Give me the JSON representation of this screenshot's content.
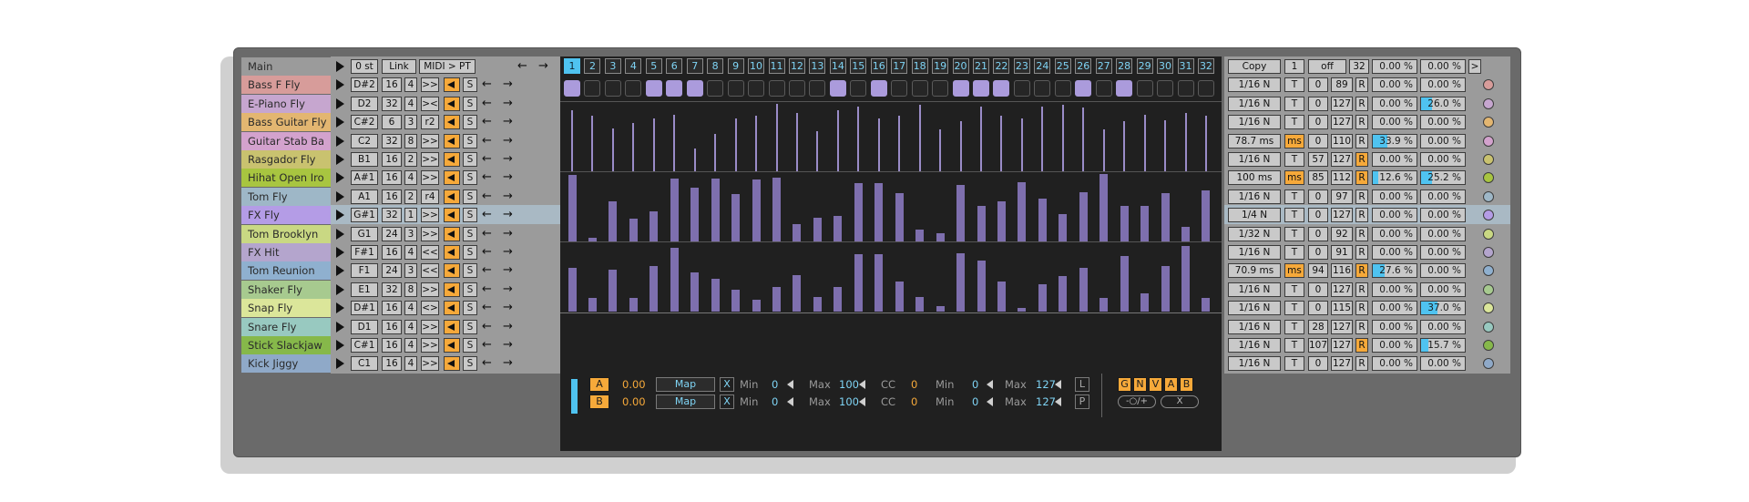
{
  "header": {
    "label": "Main",
    "transpose": "0 st",
    "link": "Link",
    "midi": "MIDI > PT",
    "copy": "Copy",
    "copy_n": "1",
    "mode": "off",
    "len": "32",
    "pct1": "0.00 %",
    "pct2": "0.00 %",
    "next": ">"
  },
  "steps": [
    "1",
    "2",
    "3",
    "4",
    "5",
    "6",
    "7",
    "8",
    "9",
    "10",
    "11",
    "12",
    "13",
    "14",
    "15",
    "16",
    "17",
    "18",
    "19",
    "20",
    "21",
    "22",
    "23",
    "24",
    "25",
    "26",
    "27",
    "28",
    "29",
    "30",
    "31",
    "32"
  ],
  "active_step_index": 0,
  "triggers_on": [
    1,
    0,
    0,
    0,
    1,
    1,
    1,
    0,
    0,
    0,
    0,
    0,
    0,
    1,
    0,
    1,
    0,
    0,
    0,
    1,
    1,
    1,
    0,
    0,
    0,
    1,
    0,
    1,
    0,
    0,
    0,
    0
  ],
  "velocity_lane": [
    0.9,
    0.82,
    0.64,
    0.72,
    0.78,
    0.84,
    0.34,
    0.56,
    0.78,
    0.82,
    1.0,
    0.87,
    0.6,
    0.9,
    0.96,
    0.78,
    0.82,
    0.98,
    0.62,
    0.74,
    0.96,
    0.83,
    0.78,
    0.96,
    0.98,
    0.95,
    0.62,
    0.74,
    0.84,
    0.75,
    0.87,
    0.82
  ],
  "lane2": [
    0.98,
    0.05,
    0.6,
    0.34,
    0.44,
    0.93,
    0.8,
    0.93,
    0.7,
    0.92,
    0.95,
    0.25,
    0.35,
    0.38,
    0.87,
    0.87,
    0.72,
    0.17,
    0.12,
    0.84,
    0.53,
    0.6,
    0.88,
    0.64,
    0.4,
    0.73,
    1.0,
    0.53,
    0.53,
    0.72,
    0.22,
    0.76
  ],
  "lane3": [
    0.65,
    0.2,
    0.62,
    0.2,
    0.67,
    0.95,
    0.58,
    0.48,
    0.33,
    0.17,
    0.37,
    0.54,
    0.21,
    0.37,
    0.85,
    0.85,
    0.45,
    0.22,
    0.08,
    0.86,
    0.75,
    0.44,
    0.05,
    0.41,
    0.53,
    0.65,
    0.2,
    0.82,
    0.27,
    0.68,
    0.97,
    0.2
  ],
  "tracks": [
    {
      "name": "Bass F Fly",
      "color": "#d79c9a",
      "note": "D#2",
      "a": "16",
      "b": "4",
      "c": ">>",
      "rate": "1/16 N",
      "t": "T",
      "v1": "0",
      "v2": "89",
      "r": "R",
      "ron": false,
      "p1": "0.00 %",
      "f1": 0,
      "p2": "0.00 %",
      "f2": 0,
      "dot": "#d79c9a"
    },
    {
      "name": "E-Piano Fly",
      "color": "#c6a6cf",
      "note": "D2",
      "a": "32",
      "b": "4",
      "c": "><",
      "rate": "1/16 N",
      "t": "T",
      "v1": "0",
      "v2": "127",
      "r": "R",
      "ron": false,
      "p1": "0.00 %",
      "f1": 0,
      "p2": "26.0 %",
      "f2": 0.26,
      "dot": "#c6a6cf"
    },
    {
      "name": "Bass Guitar Fly",
      "color": "#e3b671",
      "note": "C#2",
      "a": "6",
      "b": "3",
      "c": "r2",
      "rate": "1/16 N",
      "t": "T",
      "v1": "0",
      "v2": "127",
      "r": "R",
      "ron": false,
      "p1": "0.00 %",
      "f1": 0,
      "p2": "0.00 %",
      "f2": 0,
      "dot": "#e3b671"
    },
    {
      "name": "Guitar Stab Ba",
      "color": "#d3a2cd",
      "note": "C2",
      "a": "32",
      "b": "8",
      "c": ">>",
      "rate": "78.7 ms",
      "t": "ms",
      "ton": true,
      "v1": "0",
      "v2": "110",
      "r": "R",
      "ron": false,
      "p1": "33.9 %",
      "f1": 0.339,
      "p2": "0.00 %",
      "f2": 0,
      "dot": "#d3a2cd"
    },
    {
      "name": "Rasgador Fly",
      "color": "#c9c26f",
      "note": "B1",
      "a": "16",
      "b": "2",
      "c": ">>",
      "rate": "1/16 N",
      "t": "T",
      "v1": "57",
      "v2": "127",
      "r": "R",
      "ron": true,
      "p1": "0.00 %",
      "f1": 0,
      "p2": "0.00 %",
      "f2": 0,
      "dot": "#c9c26f"
    },
    {
      "name": "Hihat Open Iro",
      "color": "#a8c540",
      "note": "A#1",
      "a": "16",
      "b": "4",
      "c": ">>",
      "rate": "100 ms",
      "t": "ms",
      "ton": true,
      "v1": "85",
      "v2": "112",
      "r": "R",
      "ron": true,
      "p1": "12.6 %",
      "f1": 0.126,
      "p2": "25.2 %",
      "f2": 0.252,
      "dot": "#a8c540"
    },
    {
      "name": "Tom Fly",
      "color": "#9eb7c7",
      "note": "A1",
      "a": "16",
      "b": "2",
      "c": "r4",
      "rate": "1/16 N",
      "t": "T",
      "v1": "0",
      "v2": "97",
      "r": "R",
      "ron": false,
      "p1": "0.00 %",
      "f1": 0,
      "p2": "0.00 %",
      "f2": 0,
      "dot": "#9eb7c7"
    },
    {
      "name": "FX Fly",
      "color": "#b49ce6",
      "note": "G#1",
      "a": "32",
      "b": "1",
      "c": ">>",
      "rate": "1/4 N",
      "t": "T",
      "v1": "0",
      "v2": "127",
      "r": "R",
      "ron": false,
      "p1": "0.00 %",
      "f1": 0,
      "p2": "0.00 %",
      "f2": 0,
      "dot": "#b49ce6",
      "selected": true
    },
    {
      "name": "Tom Brooklyn",
      "color": "#c9d883",
      "note": "G1",
      "a": "24",
      "b": "3",
      "c": ">>",
      "rate": "1/32 N",
      "t": "T",
      "v1": "0",
      "v2": "92",
      "r": "R",
      "ron": false,
      "p1": "0.00 %",
      "f1": 0,
      "p2": "0.00 %",
      "f2": 0,
      "dot": "#c9d883"
    },
    {
      "name": "FX Hit",
      "color": "#b4a5cd",
      "note": "F#1",
      "a": "16",
      "b": "4",
      "c": "<<",
      "rate": "1/16 N",
      "t": "T",
      "v1": "0",
      "v2": "91",
      "r": "R",
      "ron": false,
      "p1": "0.00 %",
      "f1": 0,
      "p2": "0.00 %",
      "f2": 0,
      "dot": "#b4a5cd"
    },
    {
      "name": "Tom Reunion",
      "color": "#8fb0cf",
      "note": "F1",
      "a": "24",
      "b": "3",
      "c": "<<",
      "rate": "70.9 ms",
      "t": "ms",
      "ton": true,
      "v1": "94",
      "v2": "116",
      "r": "R",
      "ron": true,
      "p1": "27.6 %",
      "f1": 0.276,
      "p2": "0.00 %",
      "f2": 0,
      "dot": "#8fb0cf"
    },
    {
      "name": "Shaker Fly",
      "color": "#a7ca8f",
      "note": "E1",
      "a": "32",
      "b": "8",
      "c": ">>",
      "rate": "1/16 N",
      "t": "T",
      "v1": "0",
      "v2": "127",
      "r": "R",
      "ron": false,
      "p1": "0.00 %",
      "f1": 0,
      "p2": "0.00 %",
      "f2": 0,
      "dot": "#a7ca8f"
    },
    {
      "name": "Snap Fly",
      "color": "#dbe69a",
      "note": "D#1",
      "a": "16",
      "b": "4",
      "c": "<>",
      "rate": "1/16 N",
      "t": "T",
      "v1": "0",
      "v2": "115",
      "r": "R",
      "ron": false,
      "p1": "0.00 %",
      "f1": 0,
      "p2": "37.0 %",
      "f2": 0.37,
      "dot": "#dbe69a"
    },
    {
      "name": "Snare Fly",
      "color": "#98c9c0",
      "note": "D1",
      "a": "16",
      "b": "4",
      "c": ">>",
      "rate": "1/16 N",
      "t": "T",
      "v1": "28",
      "v2": "127",
      "r": "R",
      "ron": false,
      "p1": "0.00 %",
      "f1": 0,
      "p2": "0.00 %",
      "f2": 0,
      "dot": "#98c9c0"
    },
    {
      "name": "Stick Slackjaw",
      "color": "#86b84a",
      "note": "C#1",
      "a": "16",
      "b": "4",
      "c": ">>",
      "rate": "1/16 N",
      "t": "T",
      "v1": "107",
      "v2": "127",
      "r": "R",
      "ron": true,
      "p1": "0.00 %",
      "f1": 0,
      "p2": "15.7 %",
      "f2": 0.157,
      "dot": "#86b84a"
    },
    {
      "name": "Kick Jiggy",
      "color": "#8fa9c8",
      "note": "C1",
      "a": "16",
      "b": "4",
      "c": ">>",
      "rate": "1/16 N",
      "t": "T",
      "v1": "0",
      "v2": "127",
      "r": "R",
      "ron": false,
      "p1": "0.00 %",
      "f1": 0,
      "p2": "0.00 %",
      "f2": 0,
      "dot": "#8fa9c8"
    }
  ],
  "controls": {
    "a": {
      "btn": "A",
      "val": "0.00",
      "map": "Map",
      "x": "X",
      "min_lbl": "Min",
      "min": "0",
      "max_lbl": "Max",
      "max": "100",
      "cc_lbl": "CC",
      "cc": "0",
      "min2_lbl": "Min",
      "min2": "0",
      "max2_lbl": "Max",
      "max2": "127",
      "side": "L"
    },
    "b": {
      "btn": "B",
      "val": "0.00",
      "map": "Map",
      "x": "X",
      "min_lbl": "Min",
      "min": "0",
      "max_lbl": "Max",
      "max": "100",
      "cc_lbl": "CC",
      "cc": "0",
      "min2_lbl": "Min",
      "min2": "0",
      "max2_lbl": "Max",
      "max2": "127",
      "side": "P"
    },
    "gnvab": [
      "G",
      "N",
      "V",
      "A",
      "B"
    ],
    "pill1": "-○/+",
    "pill2": "X"
  },
  "colors": {
    "accent": "#f6a93a",
    "cyan": "#4fc3f0",
    "bar": "#7e6fae",
    "trig_on": "#ab9bdc"
  }
}
